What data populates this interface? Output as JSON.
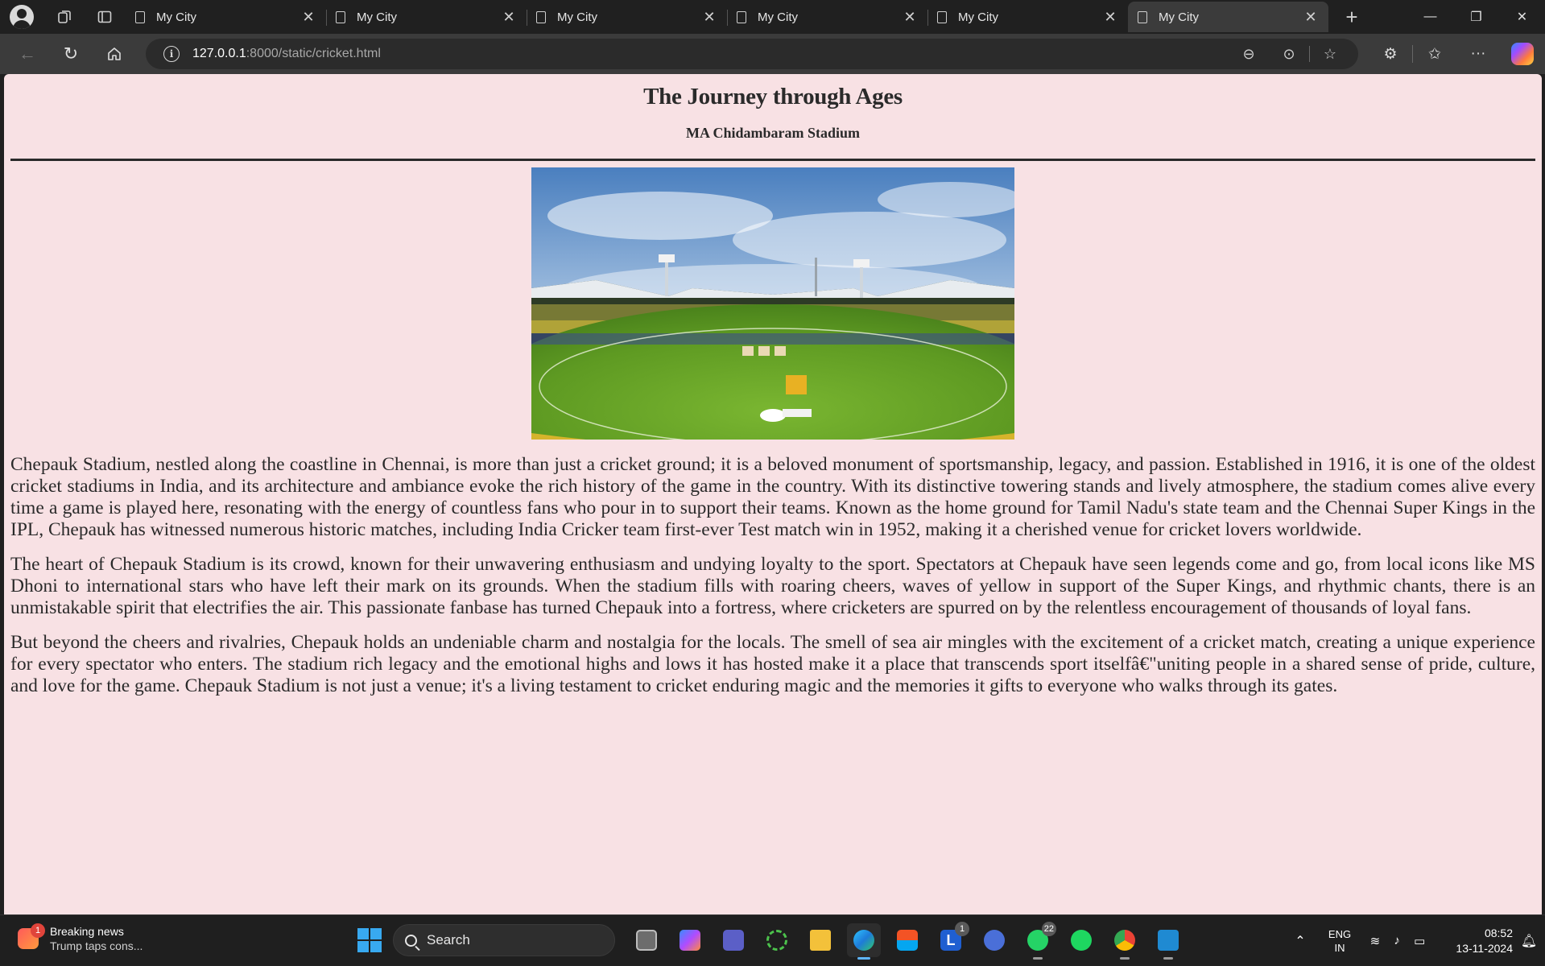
{
  "browser": {
    "tabs": [
      {
        "title": "My City",
        "active": false
      },
      {
        "title": "My City",
        "active": false
      },
      {
        "title": "My City",
        "active": false
      },
      {
        "title": "My City",
        "active": false
      },
      {
        "title": "My City",
        "active": false
      },
      {
        "title": "My City",
        "active": true
      }
    ],
    "address": {
      "host": "127.0.0.1",
      "path": ":8000/static/cricket.html"
    }
  },
  "page": {
    "heading": "The Journey through Ages",
    "subheading": "MA Chidambaram Stadium",
    "image_alt": "MA Chidambaram Stadium cricket ground",
    "paragraphs": [
      "Chepauk Stadium, nestled along the coastline in Chennai, is more than just a cricket ground; it is a beloved monument of sportsmanship, legacy, and passion. Established in 1916, it is one of the oldest cricket stadiums in India, and its architecture and ambiance evoke the rich history of the game in the country. With its distinctive towering stands and lively atmosphere, the stadium comes alive every time a game is played here, resonating with the energy of countless fans who pour in to support their teams. Known as the home ground for Tamil Nadu's state team and the Chennai Super Kings in the IPL, Chepauk has witnessed numerous historic matches, including India Cricker team first-ever Test match win in 1952, making it a cherished venue for cricket lovers worldwide.",
      "The heart of Chepauk Stadium is its crowd, known for their unwavering enthusiasm and undying loyalty to the sport. Spectators at Chepauk have seen legends come and go, from local icons like MS Dhoni to international stars who have left their mark on its grounds. When the stadium fills with roaring cheers, waves of yellow in support of the Super Kings, and rhythmic chants, there is an unmistakable spirit that electrifies the air. This passionate fanbase has turned Chepauk into a fortress, where cricketers are spurred on by the relentless encouragement of thousands of loyal fans.",
      "But beyond the cheers and rivalries, Chepauk holds an undeniable charm and nostalgia for the locals. The smell of sea air mingles with the excitement of a cricket match, creating a unique experience for every spectator who enters. The stadium rich legacy and the emotional highs and lows it has hosted make it a place that transcends sport itselfâ€\"uniting people in a shared sense of pride, culture, and love for the game. Chepauk Stadium is not just a venue; it's a living testament to cricket enduring magic and the memories it gifts to everyone who walks through its gates."
    ]
  },
  "taskbar": {
    "news_badge": "1",
    "news_title": "Breaking news",
    "news_subtitle": "Trump taps cons...",
    "search_label": "Search",
    "apps": [
      {
        "name": "task-view",
        "badge": ""
      },
      {
        "name": "copilot",
        "badge": ""
      },
      {
        "name": "teams",
        "badge": ""
      },
      {
        "name": "app-green-ring",
        "badge": ""
      },
      {
        "name": "file-explorer",
        "badge": ""
      },
      {
        "name": "edge",
        "badge": "",
        "active": true
      },
      {
        "name": "microsoft-store",
        "badge": ""
      },
      {
        "name": "app-l",
        "badge": "1"
      },
      {
        "name": "app-triangle",
        "badge": ""
      },
      {
        "name": "whatsapp",
        "badge": "22"
      },
      {
        "name": "spotify",
        "badge": ""
      },
      {
        "name": "chrome",
        "badge": ""
      },
      {
        "name": "vscode",
        "badge": ""
      }
    ],
    "lang_line1": "ENG",
    "lang_line2": "IN",
    "time": "08:52",
    "date": "13-11-2024"
  },
  "colors": {
    "page_bg": "#f8e1e4",
    "browser_chrome": "#202020",
    "toolbar": "#3b3b3b"
  }
}
